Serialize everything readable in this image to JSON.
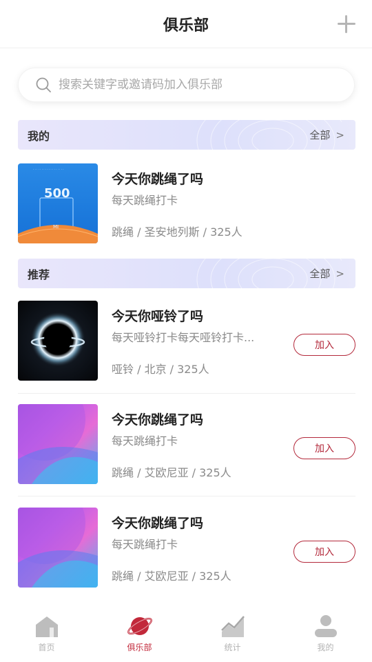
{
  "header": {
    "title": "俱乐部",
    "add_icon": "plus-icon"
  },
  "search": {
    "placeholder": "搜索关键字或邀请码加入俱乐部",
    "icon": "search-icon"
  },
  "sections": {
    "mine": {
      "label": "我的",
      "more_label": "全部",
      "chevron": ">"
    },
    "recommended": {
      "label": "推荐",
      "more_label": "全部",
      "chevron": ">"
    }
  },
  "my_clubs": [
    {
      "name": "今天你跳绳了吗",
      "description": "每天跳绳打卡",
      "meta": "跳绳 / 圣安地列斯 / 325人",
      "thumb_number": "500",
      "thumb_caption": "MI"
    }
  ],
  "recommended_clubs": [
    {
      "name": "今天你哑铃了吗",
      "description": "每天哑铃打卡每天哑铃打卡...",
      "meta": "哑铃 / 北京 / 325人",
      "join_label": "加入"
    },
    {
      "name": "今天你跳绳了吗",
      "description": "每天跳绳打卡",
      "meta": "跳绳 / 艾欧尼亚 / 325人",
      "join_label": "加入"
    },
    {
      "name": "今天你跳绳了吗",
      "description": "每天跳绳打卡",
      "meta": "跳绳 / 艾欧尼亚 / 325人",
      "join_label": "加入"
    }
  ],
  "tabbar": {
    "items": [
      {
        "label": "首页",
        "icon": "home-icon",
        "active": false
      },
      {
        "label": "俱乐部",
        "icon": "planet-icon",
        "active": true
      },
      {
        "label": "统计",
        "icon": "chart-icon",
        "active": false
      },
      {
        "label": "我的",
        "icon": "user-icon",
        "active": false
      }
    ]
  },
  "colors": {
    "accent": "#c2283a",
    "join_border": "#b3283a",
    "inactive_tab": "#b3b3b3"
  }
}
